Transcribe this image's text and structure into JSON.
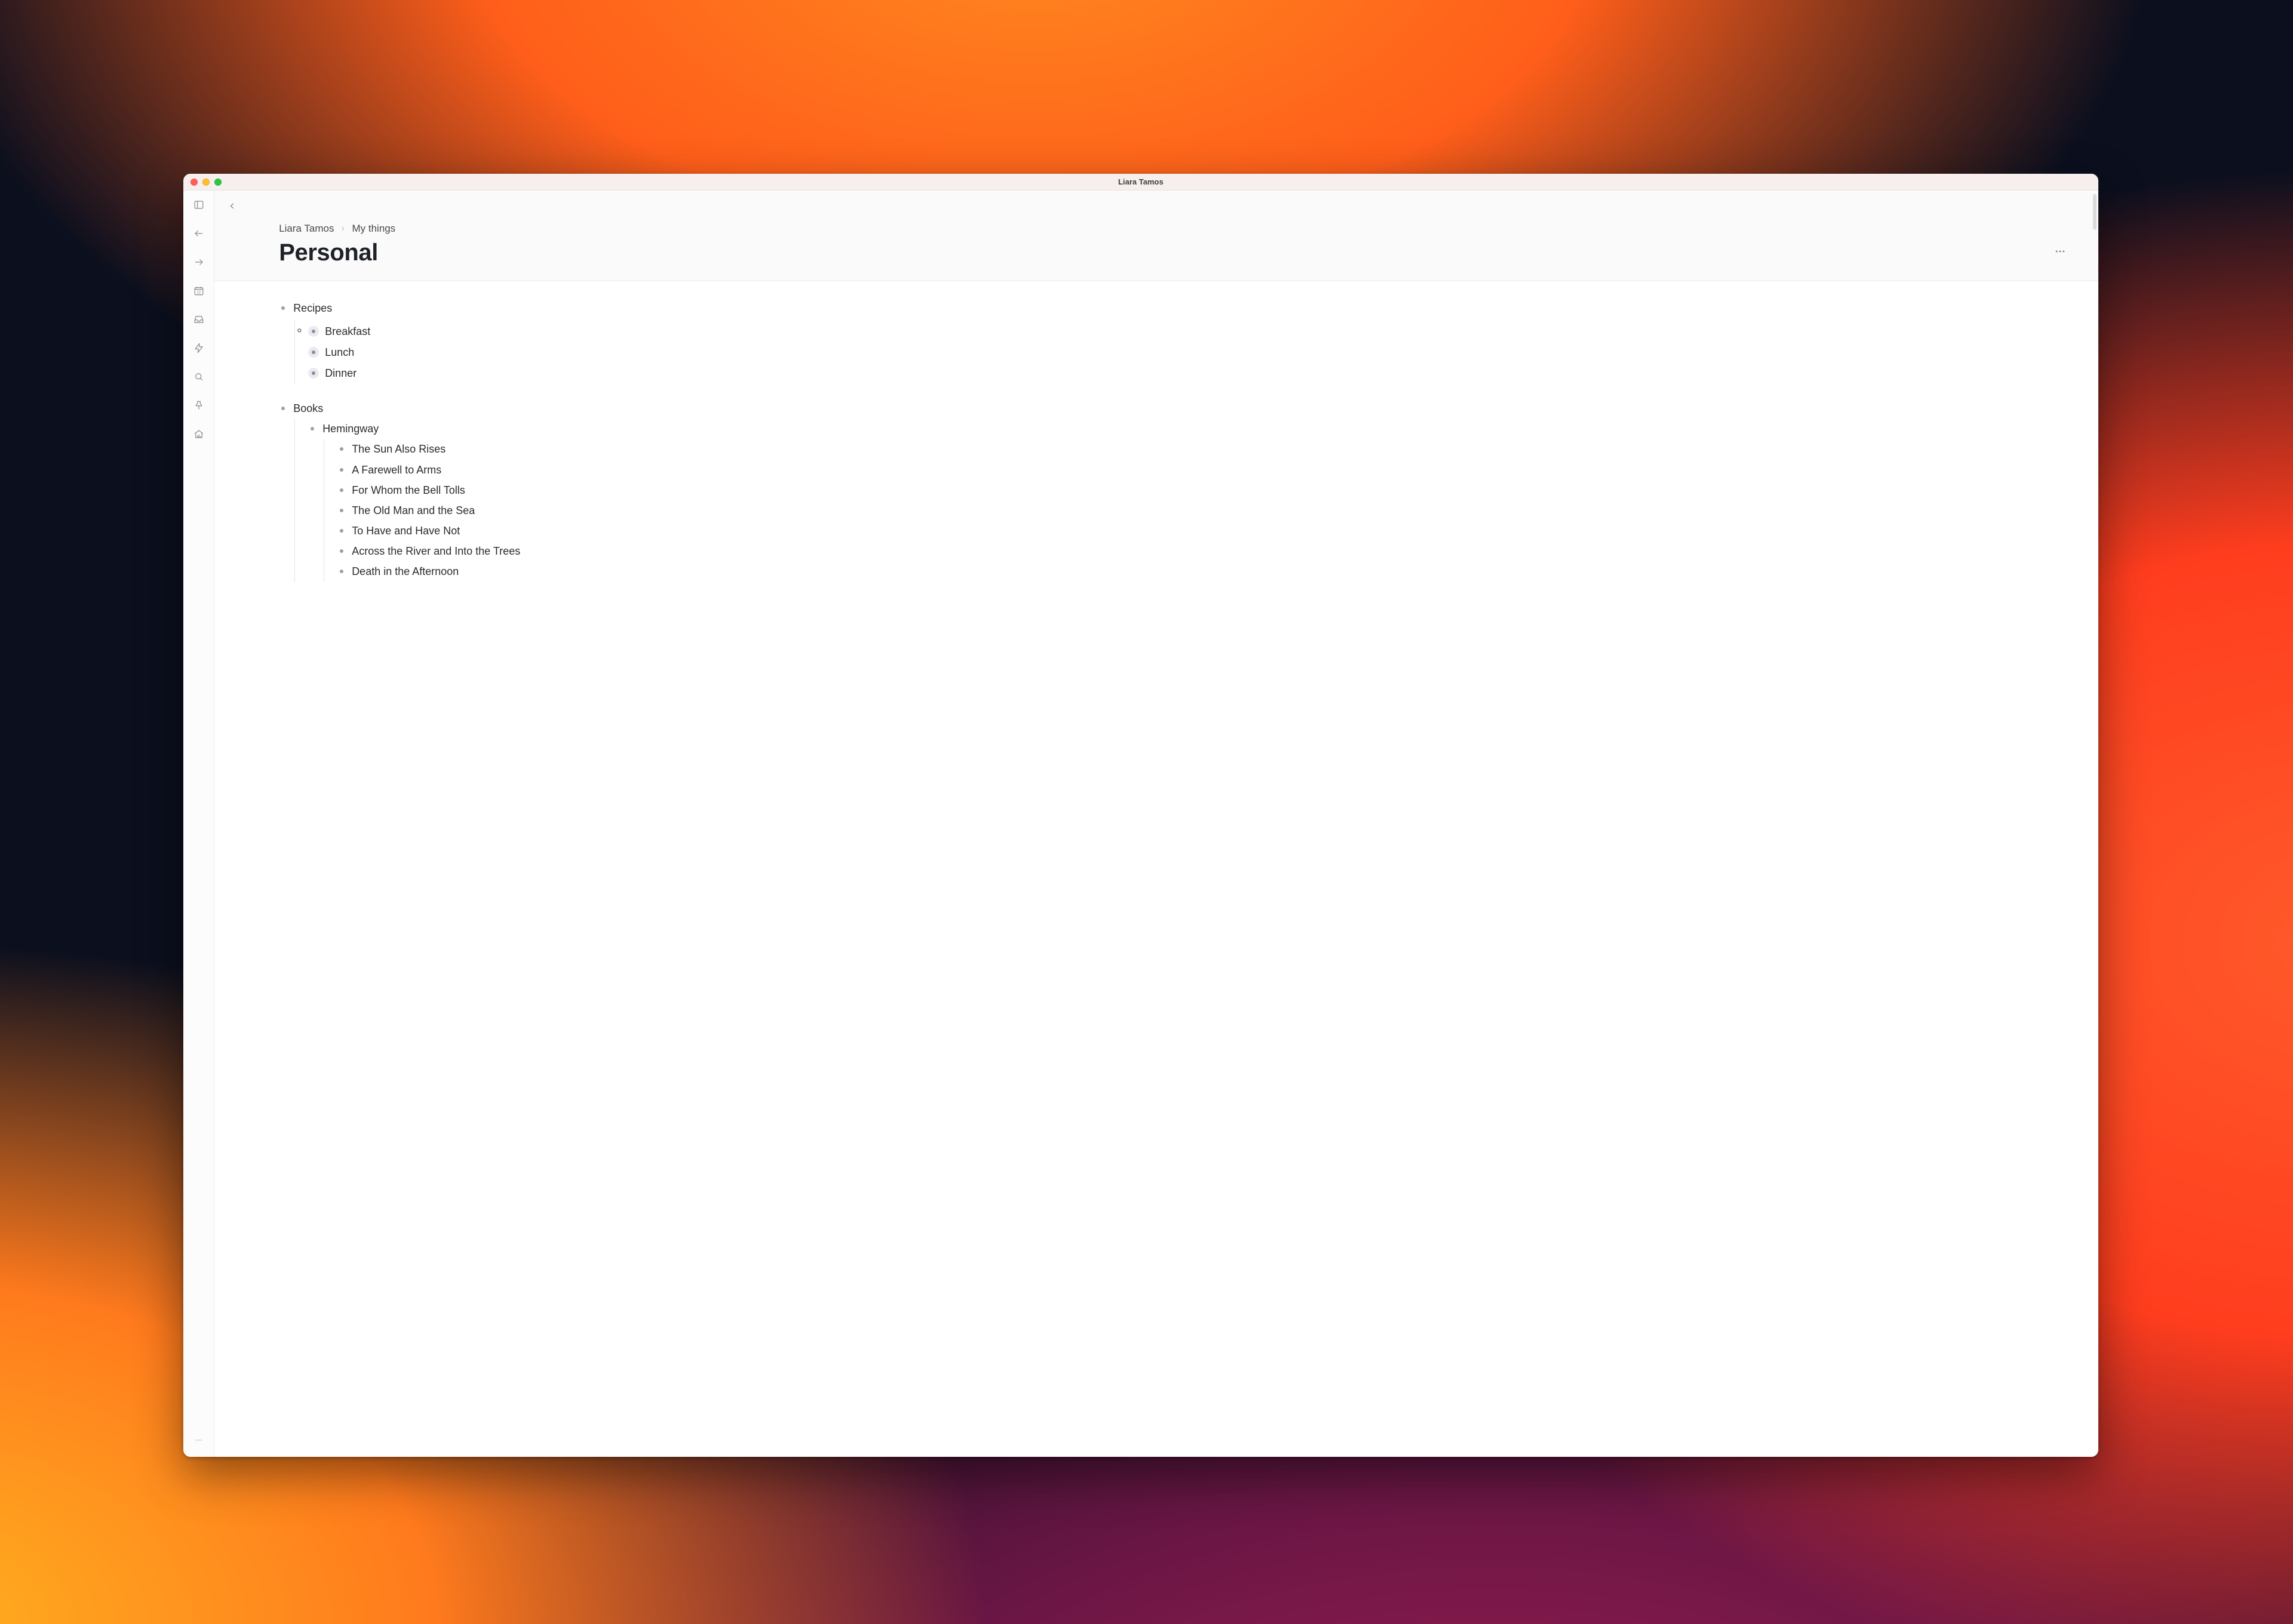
{
  "window": {
    "title": "Liara Tamos"
  },
  "breadcrumb": {
    "root": "Liara Tamos",
    "section": "My things"
  },
  "page": {
    "title": "Personal"
  },
  "recipes": {
    "label": "Recipes",
    "items": [
      {
        "label": "Breakfast"
      },
      {
        "label": "Lunch"
      },
      {
        "label": "Dinner"
      }
    ]
  },
  "books": {
    "label": "Books",
    "authors": [
      {
        "name": "Hemingway",
        "works": [
          "The Sun Also Rises",
          "A Farewell to Arms",
          "For Whom the Bell Tolls",
          "The Old Man and the Sea",
          "To Have and Have Not",
          "Across the River and Into the Trees",
          "Death in the Afternoon"
        ]
      }
    ]
  }
}
